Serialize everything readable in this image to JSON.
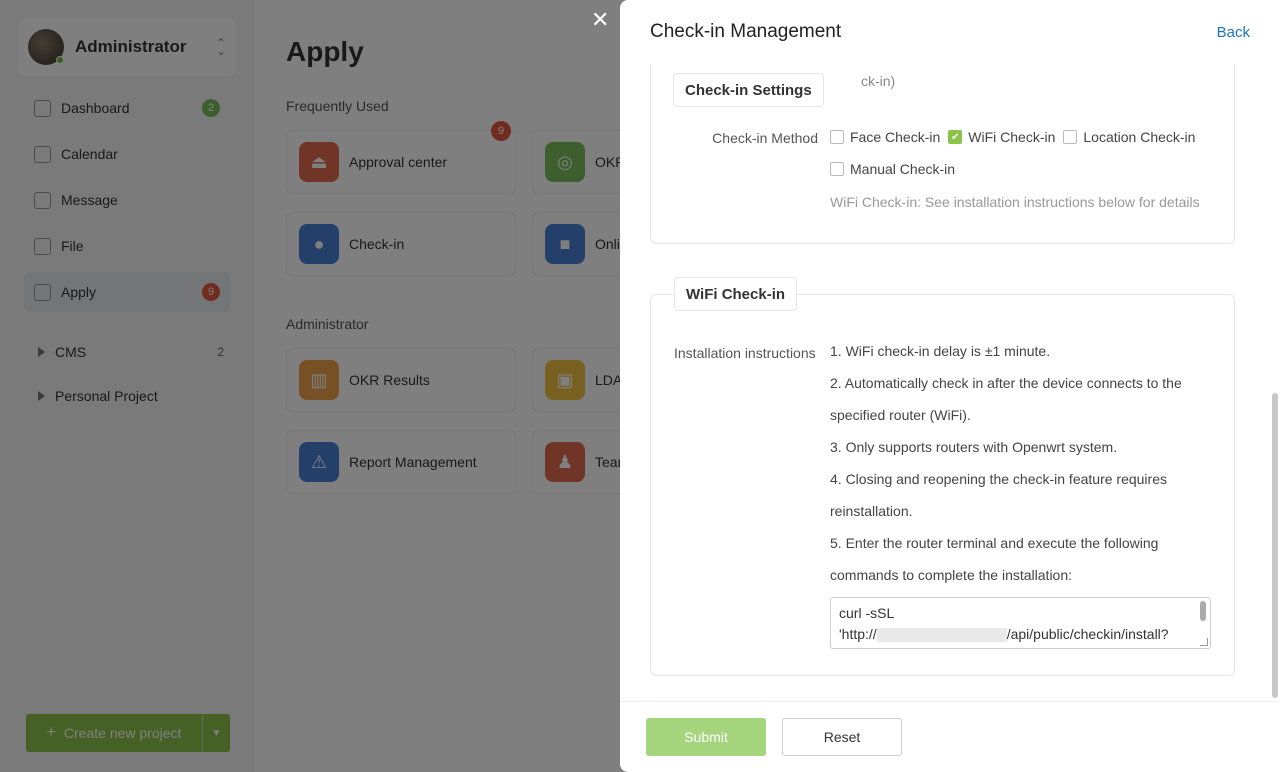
{
  "sidebar": {
    "user_name": "Administrator",
    "nav": [
      {
        "label": "Dashboard",
        "badge": "2",
        "icon": "dashboard-icon"
      },
      {
        "label": "Calendar",
        "badge": "",
        "icon": "calendar-icon"
      },
      {
        "label": "Message",
        "badge": "",
        "icon": "message-icon"
      },
      {
        "label": "File",
        "badge": "",
        "icon": "file-icon"
      },
      {
        "label": "Apply",
        "badge": "9",
        "icon": "apply-icon"
      }
    ],
    "projects": [
      {
        "label": "CMS",
        "count": "2"
      },
      {
        "label": "Personal Project",
        "count": ""
      }
    ],
    "create_label": "Create new project"
  },
  "main": {
    "title": "Apply",
    "frequent_title": "Frequently Used",
    "frequent": [
      {
        "label": "Approval center",
        "badge": "9",
        "color": "#e06b4f",
        "icon": "stamp-icon"
      },
      {
        "label": "OKR",
        "color": "#7bbf5a",
        "icon": "target-icon"
      },
      {
        "label": "Check-in",
        "color": "#4b7fd6",
        "icon": "location-pin-icon"
      },
      {
        "label": "Onli",
        "color": "#4b7fd6",
        "icon": "video-icon"
      }
    ],
    "admin_title": "Administrator",
    "admin": [
      {
        "label": "OKR Results",
        "color": "#f0a04b",
        "icon": "bar-chart-icon"
      },
      {
        "label": "LDA",
        "color": "#f0c040",
        "icon": "contact-card-icon"
      },
      {
        "label": "Report Management",
        "color": "#4b7fd6",
        "icon": "warning-icon"
      },
      {
        "label": "Tear",
        "color": "#e06b4f",
        "icon": "team-icon"
      }
    ]
  },
  "drawer": {
    "title": "Check-in Management",
    "back_label": "Back",
    "settings": {
      "legend": "Check-in Settings",
      "cut_text": "ck-in)",
      "method_label": "Check-in Method",
      "methods": [
        {
          "label": "Face Check-in",
          "checked": false
        },
        {
          "label": "WiFi Check-in",
          "checked": true
        },
        {
          "label": "Location Check-in",
          "checked": false
        },
        {
          "label": "Manual Check-in",
          "checked": false
        }
      ],
      "hint": "WiFi Check-in: See installation instructions below for details"
    },
    "wifi": {
      "legend": "WiFi Check-in",
      "instructions_label": "Installation instructions",
      "steps": [
        "1. WiFi check-in delay is ±1 minute.",
        "2. Automatically check in after the device connects to the specified router (WiFi).",
        "3. Only supports routers with Openwrt system.",
        "4. Closing and reopening the check-in feature requires reinstallation.",
        "5. Enter the router terminal and execute the following commands to complete the installation:"
      ],
      "code_line1": "curl -sSL",
      "code_line2_start": "'http://",
      "code_line2_end": "/api/public/checkin/install?"
    },
    "submit_label": "Submit",
    "reset_label": "Reset"
  }
}
